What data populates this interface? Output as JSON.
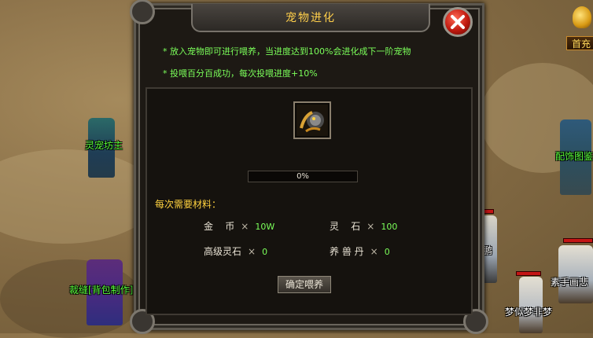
{
  "panel": {
    "title": "宠物进化",
    "info_lines": [
      "* 放入宠物即可进行喂养，当进度达到100%会进化成下一阶宠物",
      "* 投喂百分百成功，每次投喂进度+10%"
    ],
    "progress": {
      "text": "0%",
      "value": 0
    },
    "materials_heading": "每次需要材料：",
    "materials": [
      {
        "name": "金    币",
        "x": "×",
        "value": "10W"
      },
      {
        "name": "灵    石",
        "x": "×",
        "value": "100"
      },
      {
        "name": "高级灵石",
        "x": "×",
        "value": "0"
      },
      {
        "name": "养 兽 丹",
        "x": "×",
        "value": "0"
      }
    ],
    "confirm_label": "确定喂养"
  },
  "top_right": {
    "label": "首充"
  },
  "npcs": [
    {
      "label": "灵宠坊主",
      "color": "#59ff3b"
    },
    {
      "label": "裁缝[背包制作]",
      "color": "#59ff3b"
    },
    {
      "label": "配饰图鉴",
      "color": "#59ff3b"
    },
    {
      "label": "义鹏",
      "color": "#ffffff"
    },
    {
      "label": "素手画悲",
      "color": "#ffffff"
    },
    {
      "label": "梦似梦非梦",
      "color": "#ffffff"
    }
  ]
}
